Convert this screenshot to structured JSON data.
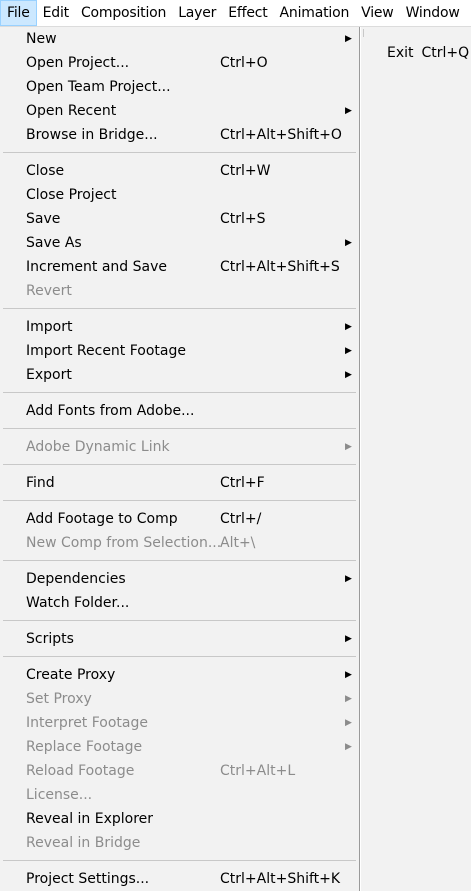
{
  "menubar": {
    "items": [
      "File",
      "Edit",
      "Composition",
      "Layer",
      "Effect",
      "Animation",
      "View",
      "Window"
    ],
    "active_index": 0
  },
  "file_menu": {
    "groups": [
      [
        {
          "label": "New",
          "shortcut": "",
          "submenu": true,
          "disabled": false
        },
        {
          "label": "Open Project...",
          "shortcut": "Ctrl+O",
          "submenu": false,
          "disabled": false
        },
        {
          "label": "Open Team Project...",
          "shortcut": "",
          "submenu": false,
          "disabled": false
        },
        {
          "label": "Open Recent",
          "shortcut": "",
          "submenu": true,
          "disabled": false
        },
        {
          "label": "Browse in Bridge...",
          "shortcut": "Ctrl+Alt+Shift+O",
          "submenu": false,
          "disabled": false
        }
      ],
      [
        {
          "label": "Close",
          "shortcut": "Ctrl+W",
          "submenu": false,
          "disabled": false
        },
        {
          "label": "Close Project",
          "shortcut": "",
          "submenu": false,
          "disabled": false
        },
        {
          "label": "Save",
          "shortcut": "Ctrl+S",
          "submenu": false,
          "disabled": false
        },
        {
          "label": "Save As",
          "shortcut": "",
          "submenu": true,
          "disabled": false
        },
        {
          "label": "Increment and Save",
          "shortcut": "Ctrl+Alt+Shift+S",
          "submenu": false,
          "disabled": false
        },
        {
          "label": "Revert",
          "shortcut": "",
          "submenu": false,
          "disabled": true
        }
      ],
      [
        {
          "label": "Import",
          "shortcut": "",
          "submenu": true,
          "disabled": false
        },
        {
          "label": "Import Recent Footage",
          "shortcut": "",
          "submenu": true,
          "disabled": false
        },
        {
          "label": "Export",
          "shortcut": "",
          "submenu": true,
          "disabled": false
        }
      ],
      [
        {
          "label": "Add Fonts from Adobe...",
          "shortcut": "",
          "submenu": false,
          "disabled": false
        }
      ],
      [
        {
          "label": "Adobe Dynamic Link",
          "shortcut": "",
          "submenu": true,
          "disabled": true
        }
      ],
      [
        {
          "label": "Find",
          "shortcut": "Ctrl+F",
          "submenu": false,
          "disabled": false
        }
      ],
      [
        {
          "label": "Add Footage to Comp",
          "shortcut": "Ctrl+/",
          "submenu": false,
          "disabled": false
        },
        {
          "label": "New Comp from Selection...",
          "shortcut": "Alt+\\",
          "submenu": false,
          "disabled": true
        }
      ],
      [
        {
          "label": "Dependencies",
          "shortcut": "",
          "submenu": true,
          "disabled": false
        },
        {
          "label": "Watch Folder...",
          "shortcut": "",
          "submenu": false,
          "disabled": false
        }
      ],
      [
        {
          "label": "Scripts",
          "shortcut": "",
          "submenu": true,
          "disabled": false
        }
      ],
      [
        {
          "label": "Create Proxy",
          "shortcut": "",
          "submenu": true,
          "disabled": false
        },
        {
          "label": "Set Proxy",
          "shortcut": "",
          "submenu": true,
          "disabled": true
        },
        {
          "label": "Interpret Footage",
          "shortcut": "",
          "submenu": true,
          "disabled": true
        },
        {
          "label": "Replace Footage",
          "shortcut": "",
          "submenu": true,
          "disabled": true
        },
        {
          "label": "Reload Footage",
          "shortcut": "Ctrl+Alt+L",
          "submenu": false,
          "disabled": true
        },
        {
          "label": "License...",
          "shortcut": "",
          "submenu": false,
          "disabled": true
        },
        {
          "label": "Reveal in Explorer",
          "shortcut": "",
          "submenu": false,
          "disabled": false
        },
        {
          "label": "Reveal in Bridge",
          "shortcut": "",
          "submenu": false,
          "disabled": true
        }
      ],
      [
        {
          "label": "Project Settings...",
          "shortcut": "Ctrl+Alt+Shift+K",
          "submenu": false,
          "disabled": false
        }
      ]
    ],
    "arrow_glyph": "▶"
  },
  "overflow_panel": {
    "exit_label": "Exit",
    "exit_shortcut": "Ctrl+Q"
  }
}
